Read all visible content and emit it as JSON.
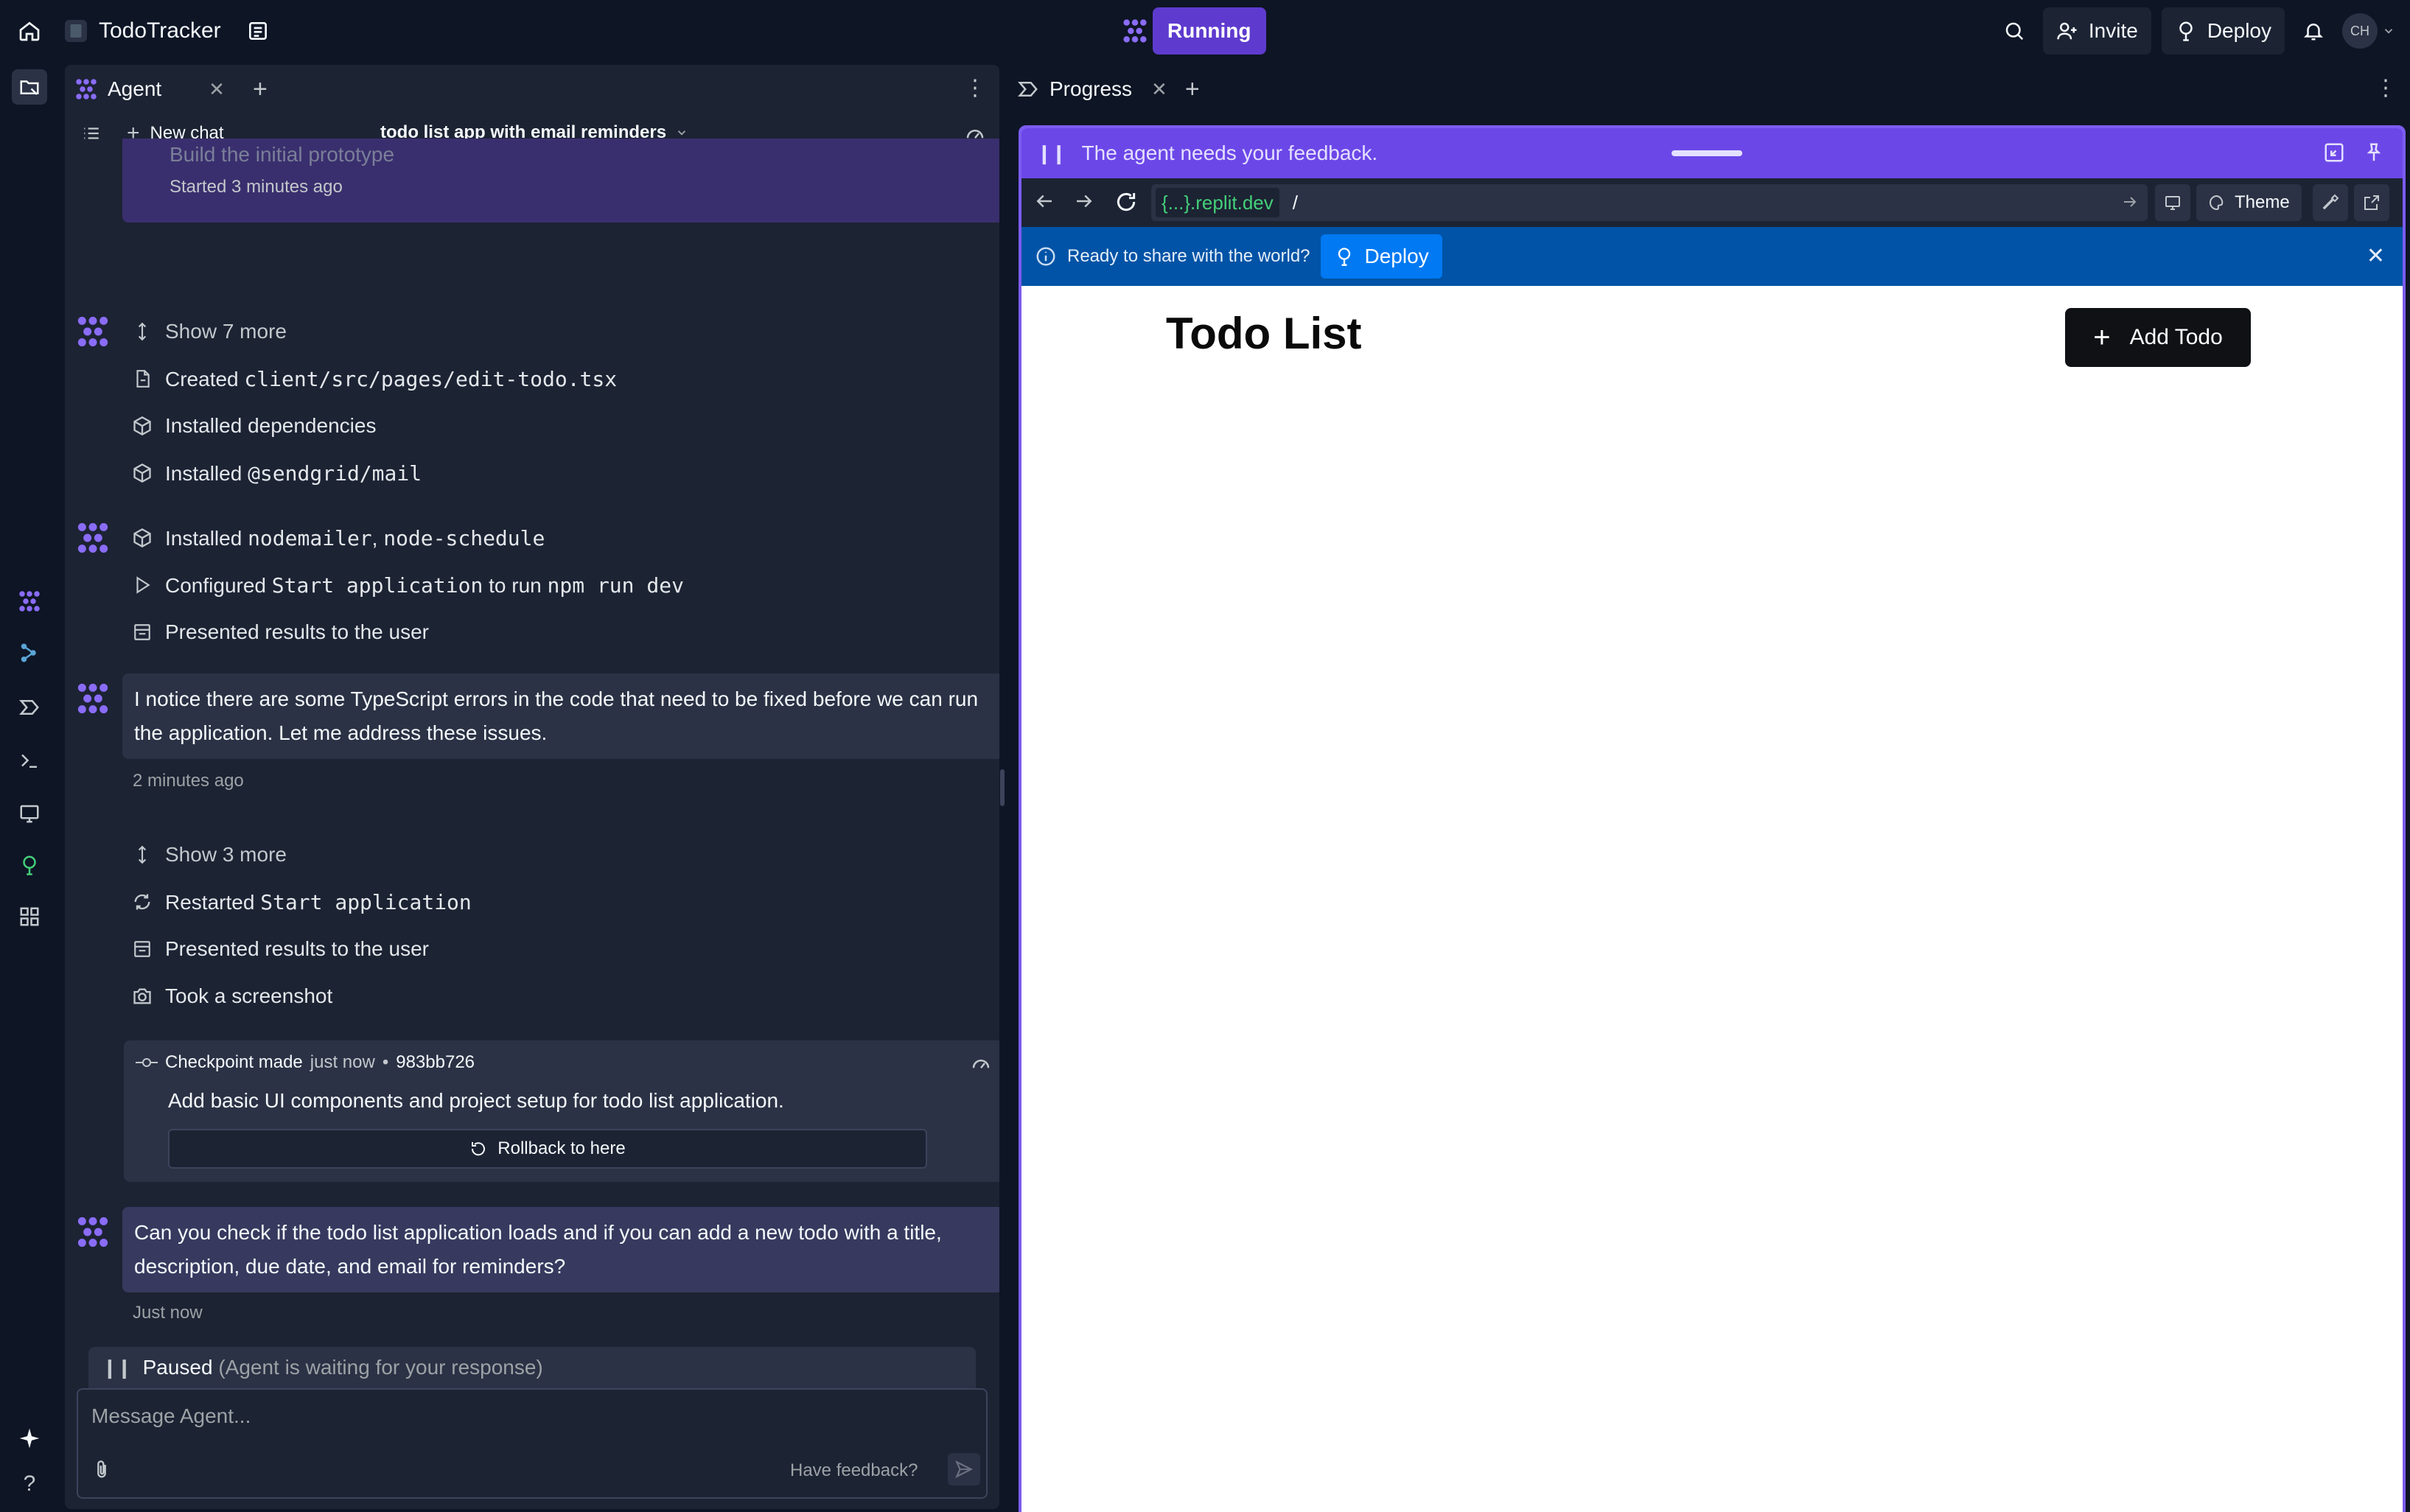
{
  "topbar": {
    "project_name": "TodoTracker",
    "run_status": "Running",
    "invite_label": "Invite",
    "deploy_label": "Deploy",
    "avatar_initials": "CH"
  },
  "agent_panel": {
    "tab_label": "Agent",
    "new_chat_label": "New chat",
    "chat_title": "todo list app with email reminders",
    "prev_task": {
      "title": "Build the initial prototype",
      "started": "Started 3 minutes ago"
    },
    "group1": {
      "show_more": "Show 7 more",
      "created_prefix": "Created",
      "created_file": "client/src/pages/edit-todo.tsx",
      "installed_deps": "Installed dependencies",
      "installed_prefix": "Installed",
      "installed_pkg": "@sendgrid/mail"
    },
    "group2": {
      "installed_prefix": "Installed",
      "pkg1": "nodemailer",
      "pkg_sep": ",",
      "pkg2": "node-schedule",
      "configured_prefix": "Configured",
      "configured_name": "Start application",
      "configured_mid": "to run",
      "configured_cmd": "npm run dev",
      "presented": "Presented results to the user"
    },
    "message1": {
      "text": "I notice there are some TypeScript errors in the code that need to be fixed before we can run the application. Let me address these issues.",
      "time": "2 minutes ago"
    },
    "group3": {
      "show_more": "Show 3 more",
      "restarted_prefix": "Restarted",
      "restarted_name": "Start application",
      "presented": "Presented results to the user",
      "screenshot": "Took a screenshot"
    },
    "checkpoint": {
      "label": "Checkpoint made",
      "when": "just now",
      "bullet": "•",
      "hash": "983bb726",
      "description": "Add basic UI components and project setup for todo list application.",
      "rollback_label": "Rollback to here"
    },
    "message2": {
      "text": "Can you check if the todo list application loads and if you can add a new todo with a title, description, due date, and email for reminders?",
      "time": "Just now"
    },
    "paused": {
      "label": "Paused",
      "detail": "(Agent is waiting for your response)"
    },
    "composer": {
      "placeholder": "Message Agent...",
      "feedback_label": "Have feedback?"
    }
  },
  "right_panel": {
    "tab_label": "Progress",
    "feedback_message": "The agent needs your feedback.",
    "url_host": "{...}.replit.dev",
    "url_path": "/",
    "theme_label": "Theme",
    "deploy_banner_text": "Ready to share with the world?",
    "deploy_label": "Deploy"
  },
  "app_preview": {
    "title": "Todo List",
    "add_label": "Add Todo"
  },
  "colors": {
    "background": "#0e1525",
    "panel": "#1c2333",
    "bubble": "#2b3245",
    "accent": "#6c47e8",
    "deploy_blue": "#0053a6"
  }
}
